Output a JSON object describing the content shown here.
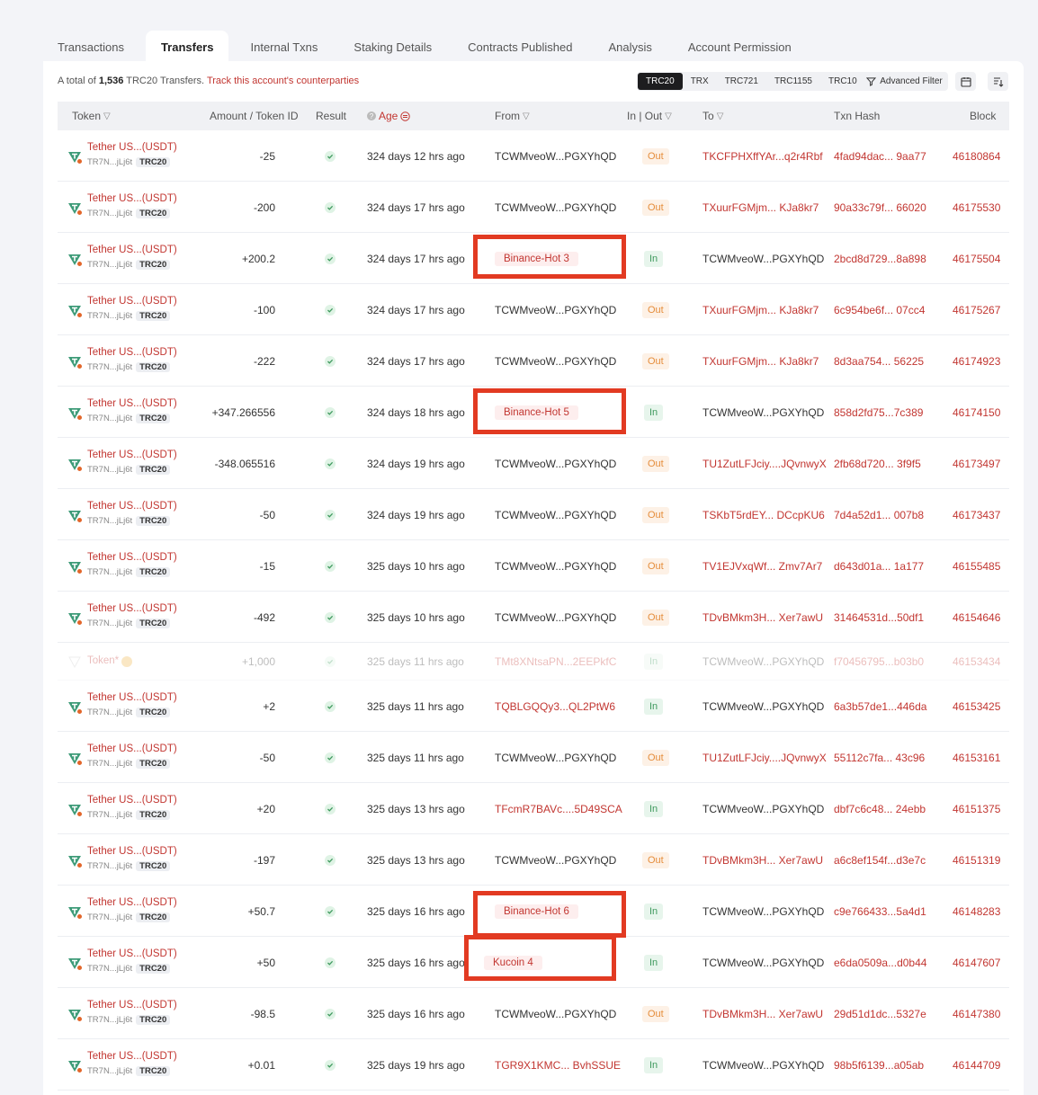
{
  "tabs": [
    "Transactions",
    "Transfers",
    "Internal Txns",
    "Staking Details",
    "Contracts Published",
    "Analysis",
    "Account Permission"
  ],
  "active_tab": "Transfers",
  "summary": {
    "prefix": "A total of ",
    "count": "1,536",
    "suffix": " TRC20 Transfers. ",
    "link": "Track this account's counterparties"
  },
  "token_types": [
    "TRC20",
    "TRX",
    "TRC721",
    "TRC1155",
    "TRC10"
  ],
  "active_type": "TRC20",
  "advanced_filter": "Advanced Filter",
  "headers": {
    "token": "Token",
    "amount": "Amount / Token ID",
    "result": "Result",
    "age": "Age",
    "from": "From",
    "inout": "In | Out",
    "to": "To",
    "hash": "Txn Hash",
    "block": "Block"
  },
  "colors": {
    "accent_red": "#c23631",
    "highlight": "#e23a22",
    "out": "#e58d3b",
    "in": "#3f9a5e"
  },
  "rows": [
    {
      "token": "Tether US...(USDT)",
      "contract": "TR7N...jLj6t",
      "std": "TRC20",
      "amount": "-25",
      "age": "324 days 12 hrs ago",
      "from": "TCWMveoW...PGXYhQD",
      "from_label": false,
      "dir": "Out",
      "to": "TKCFPHXffYAr...q2r4Rbf",
      "hash": "4fad94dac... 9aa77",
      "block": "46180864"
    },
    {
      "token": "Tether US...(USDT)",
      "contract": "TR7N...jLj6t",
      "std": "TRC20",
      "amount": "-200",
      "age": "324 days 17 hrs ago",
      "from": "TCWMveoW...PGXYhQD",
      "from_label": false,
      "dir": "Out",
      "to": "TXuurFGMjm... KJa8kr7",
      "hash": "90a33c79f... 66020",
      "block": "46175530"
    },
    {
      "token": "Tether US...(USDT)",
      "contract": "TR7N...jLj6t",
      "std": "TRC20",
      "amount": "+200.2",
      "age": "324 days 17 hrs ago",
      "from": "Binance-Hot 3",
      "from_label": true,
      "dir": "In",
      "to": "TCWMveoW...PGXYhQD",
      "hash": "2bcd8d729...8a898",
      "block": "46175504"
    },
    {
      "token": "Tether US...(USDT)",
      "contract": "TR7N...jLj6t",
      "std": "TRC20",
      "amount": "-100",
      "age": "324 days 17 hrs ago",
      "from": "TCWMveoW...PGXYhQD",
      "from_label": false,
      "dir": "Out",
      "to": "TXuurFGMjm... KJa8kr7",
      "hash": "6c954be6f... 07cc4",
      "block": "46175267"
    },
    {
      "token": "Tether US...(USDT)",
      "contract": "TR7N...jLj6t",
      "std": "TRC20",
      "amount": "-222",
      "age": "324 days 17 hrs ago",
      "from": "TCWMveoW...PGXYhQD",
      "from_label": false,
      "dir": "Out",
      "to": "TXuurFGMjm... KJa8kr7",
      "hash": "8d3aa754... 56225",
      "block": "46174923"
    },
    {
      "token": "Tether US...(USDT)",
      "contract": "TR7N...jLj6t",
      "std": "TRC20",
      "amount": "+347.266556",
      "age": "324 days 18 hrs ago",
      "from": "Binance-Hot 5",
      "from_label": true,
      "dir": "In",
      "to": "TCWMveoW...PGXYhQD",
      "hash": "858d2fd75...7c389",
      "block": "46174150"
    },
    {
      "token": "Tether US...(USDT)",
      "contract": "TR7N...jLj6t",
      "std": "TRC20",
      "amount": "-348.065516",
      "age": "324 days 19 hrs ago",
      "from": "TCWMveoW...PGXYhQD",
      "from_label": false,
      "dir": "Out",
      "to": "TU1ZutLFJciy....JQvnwyX",
      "hash": "2fb68d720... 3f9f5",
      "block": "46173497"
    },
    {
      "token": "Tether US...(USDT)",
      "contract": "TR7N...jLj6t",
      "std": "TRC20",
      "amount": "-50",
      "age": "324 days 19 hrs ago",
      "from": "TCWMveoW...PGXYhQD",
      "from_label": false,
      "dir": "Out",
      "to": "TSKbT5rdEY... DCcpKU6",
      "hash": "7d4a52d1... 007b8",
      "block": "46173437"
    },
    {
      "token": "Tether US...(USDT)",
      "contract": "TR7N...jLj6t",
      "std": "TRC20",
      "amount": "-15",
      "age": "325 days 10 hrs ago",
      "from": "TCWMveoW...PGXYhQD",
      "from_label": false,
      "dir": "Out",
      "to": "TV1EJVxqWf... Zmv7Ar7",
      "hash": "d643d01a... 1a177",
      "block": "46155485"
    },
    {
      "token": "Tether US...(USDT)",
      "contract": "TR7N...jLj6t",
      "std": "TRC20",
      "amount": "-492",
      "age": "325 days 10 hrs ago",
      "from": "TCWMveoW...PGXYhQD",
      "from_label": false,
      "dir": "Out",
      "to": "TDvBMkm3H... Xer7awU",
      "hash": "31464531d...50df1",
      "block": "46154646"
    },
    {
      "token": "Token*",
      "contract": "",
      "std": "",
      "amount": "+1,000",
      "age": "325 days 11 hrs ago",
      "from": "TMt8XNtsaPN...2EEPkfC",
      "from_label": false,
      "dir": "In",
      "to": "TCWMveoW...PGXYhQD",
      "hash": "f70456795...b03b0",
      "block": "46153434",
      "faded": true
    },
    {
      "token": "Tether US...(USDT)",
      "contract": "TR7N...jLj6t",
      "std": "TRC20",
      "amount": "+2",
      "age": "325 days 11 hrs ago",
      "from": "TQBLGQQy3...QL2PtW6",
      "from_label": false,
      "dir": "In",
      "to": "TCWMveoW...PGXYhQD",
      "hash": "6a3b57de1...446da",
      "block": "46153425"
    },
    {
      "token": "Tether US...(USDT)",
      "contract": "TR7N...jLj6t",
      "std": "TRC20",
      "amount": "-50",
      "age": "325 days 11 hrs ago",
      "from": "TCWMveoW...PGXYhQD",
      "from_label": false,
      "dir": "Out",
      "to": "TU1ZutLFJciy....JQvnwyX",
      "hash": "55112c7fa... 43c96",
      "block": "46153161"
    },
    {
      "token": "Tether US...(USDT)",
      "contract": "TR7N...jLj6t",
      "std": "TRC20",
      "amount": "+20",
      "age": "325 days 13 hrs ago",
      "from": "TFcmR7BAVc....5D49SCA",
      "from_label": false,
      "dir": "In",
      "to": "TCWMveoW...PGXYhQD",
      "hash": "dbf7c6c48... 24ebb",
      "block": "46151375"
    },
    {
      "token": "Tether US...(USDT)",
      "contract": "TR7N...jLj6t",
      "std": "TRC20",
      "amount": "-197",
      "age": "325 days 13 hrs ago",
      "from": "TCWMveoW...PGXYhQD",
      "from_label": false,
      "dir": "Out",
      "to": "TDvBMkm3H... Xer7awU",
      "hash": "a6c8ef154f...d3e7c",
      "block": "46151319"
    },
    {
      "token": "Tether US...(USDT)",
      "contract": "TR7N...jLj6t",
      "std": "TRC20",
      "amount": "+50.7",
      "age": "325 days 16 hrs ago",
      "from": "Binance-Hot 6",
      "from_label": true,
      "dir": "In",
      "to": "TCWMveoW...PGXYhQD",
      "hash": "c9e766433...5a4d1",
      "block": "46148283"
    },
    {
      "token": "Tether US...(USDT)",
      "contract": "TR7N...jLj6t",
      "std": "TRC20",
      "amount": "+50",
      "age": "325 days 16 hrs ago",
      "from": "Kucoin 4",
      "from_label": true,
      "dir": "In",
      "to": "TCWMveoW...PGXYhQD",
      "hash": "e6da0509a...d0b44",
      "block": "46147607"
    },
    {
      "token": "Tether US...(USDT)",
      "contract": "TR7N...jLj6t",
      "std": "TRC20",
      "amount": "-98.5",
      "age": "325 days 16 hrs ago",
      "from": "TCWMveoW...PGXYhQD",
      "from_label": false,
      "dir": "Out",
      "to": "TDvBMkm3H... Xer7awU",
      "hash": "29d51d1dc...5327e",
      "block": "46147380"
    },
    {
      "token": "Tether US...(USDT)",
      "contract": "TR7N...jLj6t",
      "std": "TRC20",
      "amount": "+0.01",
      "age": "325 days 19 hrs ago",
      "from": "TGR9X1KMC... BvhSSUE",
      "from_label": false,
      "dir": "In",
      "to": "TCWMveoW...PGXYhQD",
      "hash": "98b5f6139...a05ab",
      "block": "46144709"
    }
  ]
}
